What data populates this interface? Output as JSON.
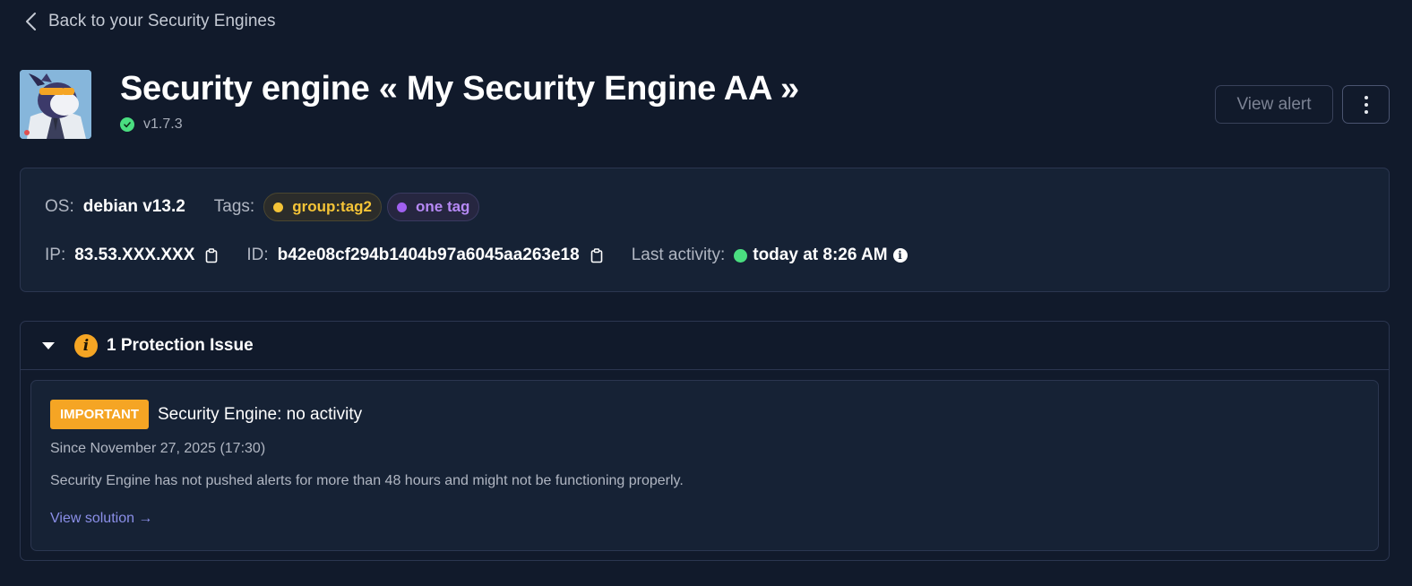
{
  "nav": {
    "back_label": "Back to your Security Engines"
  },
  "header": {
    "title": "Security engine « My Security Engine AA »",
    "version": "v1.7.3",
    "view_alert_label": "View alert"
  },
  "info": {
    "os_label": "OS:",
    "os_value": "debian v13.2",
    "tags_label": "Tags:",
    "tags": [
      {
        "label": "group:tag2",
        "color": "#f5c437"
      },
      {
        "label": "one tag",
        "color": "#a060f0"
      }
    ],
    "ip_label": "IP:",
    "ip_value": "83.53.XXX.XXX",
    "id_label": "ID:",
    "id_value": "b42e08cf294b1404b97a6045aa263e18",
    "last_activity_label": "Last activity:",
    "last_activity_value": "today at 8:26 AM"
  },
  "issues": {
    "title": "1 Protection Issue",
    "items": [
      {
        "severity": "IMPORTANT",
        "title": "Security Engine: no activity",
        "since": "Since November 27, 2025 (17:30)",
        "description": "Security Engine has not pushed alerts for more than 48 hours and might not be functioning properly.",
        "solution_label": "View solution →"
      }
    ]
  },
  "colors": {
    "background": "#111a2b",
    "card": "#162235",
    "success": "#4ade80",
    "warning": "#f5a524",
    "link": "#8b8fe8"
  }
}
